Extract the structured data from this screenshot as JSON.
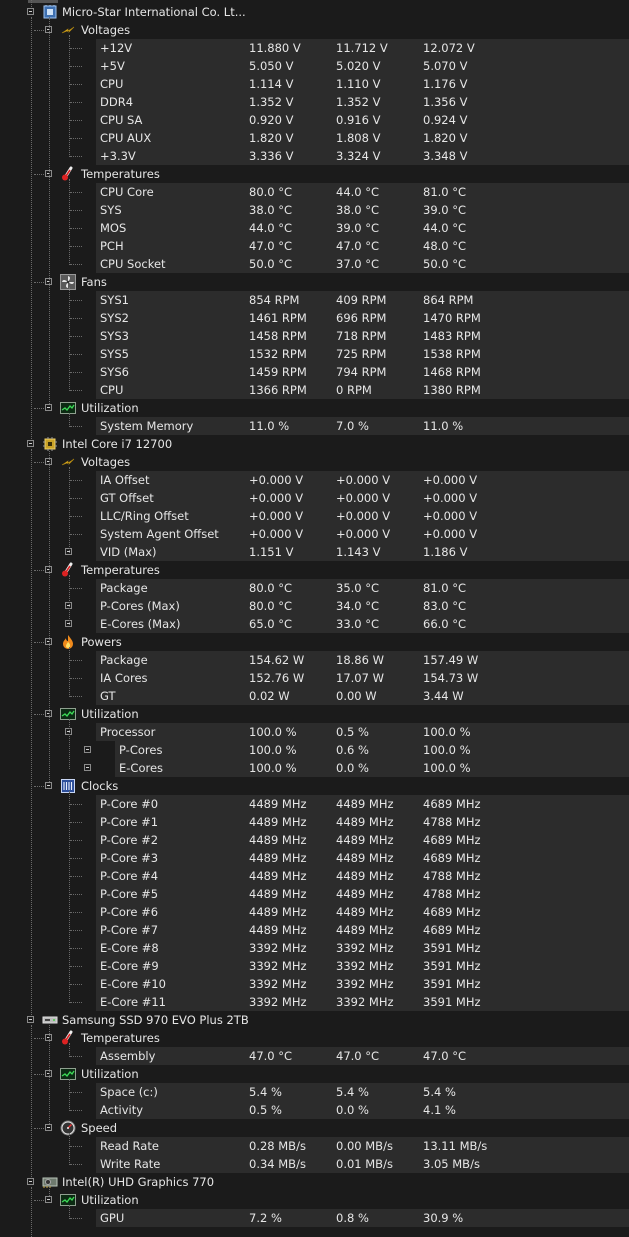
{
  "tree": [
    {
      "type": "device",
      "icon": "motherboard-icon",
      "label": "Micro-Star International Co. Lt..."
    },
    {
      "type": "group",
      "icon": "voltage-icon",
      "label": "Voltages"
    },
    {
      "type": "item",
      "label": "+12V",
      "values": [
        "11.880 V",
        "11.712 V",
        "12.072 V"
      ]
    },
    {
      "type": "item",
      "label": "+5V",
      "values": [
        "5.050 V",
        "5.020 V",
        "5.070 V"
      ]
    },
    {
      "type": "item",
      "label": "CPU",
      "values": [
        "1.114 V",
        "1.110 V",
        "1.176 V"
      ]
    },
    {
      "type": "item",
      "label": "DDR4",
      "values": [
        "1.352 V",
        "1.352 V",
        "1.356 V"
      ]
    },
    {
      "type": "item",
      "label": "CPU SA",
      "values": [
        "0.920 V",
        "0.916 V",
        "0.924 V"
      ]
    },
    {
      "type": "item",
      "label": "CPU AUX",
      "values": [
        "1.820 V",
        "1.808 V",
        "1.820 V"
      ]
    },
    {
      "type": "item",
      "label": "+3.3V",
      "values": [
        "3.336 V",
        "3.324 V",
        "3.348 V"
      ]
    },
    {
      "type": "group",
      "icon": "thermometer-icon",
      "label": "Temperatures"
    },
    {
      "type": "item",
      "label": "CPU Core",
      "values": [
        "80.0 °C",
        "44.0 °C",
        "81.0 °C"
      ]
    },
    {
      "type": "item",
      "label": "SYS",
      "values": [
        "38.0 °C",
        "38.0 °C",
        "39.0 °C"
      ]
    },
    {
      "type": "item",
      "label": "MOS",
      "values": [
        "44.0 °C",
        "39.0 °C",
        "44.0 °C"
      ]
    },
    {
      "type": "item",
      "label": "PCH",
      "values": [
        "47.0 °C",
        "47.0 °C",
        "48.0 °C"
      ]
    },
    {
      "type": "item",
      "label": "CPU Socket",
      "values": [
        "50.0 °C",
        "37.0 °C",
        "50.0 °C"
      ]
    },
    {
      "type": "group",
      "icon": "fan-icon",
      "label": "Fans"
    },
    {
      "type": "item",
      "label": "SYS1",
      "values": [
        "854 RPM",
        "409 RPM",
        "864 RPM"
      ]
    },
    {
      "type": "item",
      "label": "SYS2",
      "values": [
        "1461 RPM",
        "696 RPM",
        "1470 RPM"
      ]
    },
    {
      "type": "item",
      "label": "SYS3",
      "values": [
        "1458 RPM",
        "718 RPM",
        "1483 RPM"
      ]
    },
    {
      "type": "item",
      "label": "SYS5",
      "values": [
        "1532 RPM",
        "725 RPM",
        "1538 RPM"
      ]
    },
    {
      "type": "item",
      "label": "SYS6",
      "values": [
        "1459 RPM",
        "794 RPM",
        "1468 RPM"
      ]
    },
    {
      "type": "item",
      "label": "CPU",
      "values": [
        "1366 RPM",
        "0 RPM",
        "1380 RPM"
      ]
    },
    {
      "type": "group",
      "icon": "utilization-icon",
      "label": "Utilization"
    },
    {
      "type": "item",
      "label": "System Memory",
      "values": [
        "11.0 %",
        "7.0 %",
        "11.0 %"
      ]
    },
    {
      "type": "device",
      "icon": "cpu-chip-icon",
      "label": "Intel Core i7 12700"
    },
    {
      "type": "group",
      "icon": "voltage-icon",
      "label": "Voltages"
    },
    {
      "type": "item",
      "label": "IA Offset",
      "values": [
        "+0.000 V",
        "+0.000 V",
        "+0.000 V"
      ]
    },
    {
      "type": "item",
      "label": "GT Offset",
      "values": [
        "+0.000 V",
        "+0.000 V",
        "+0.000 V"
      ]
    },
    {
      "type": "item",
      "label": "LLC/Ring Offset",
      "values": [
        "+0.000 V",
        "+0.000 V",
        "+0.000 V"
      ]
    },
    {
      "type": "item",
      "label": "System Agent Offset",
      "values": [
        "+0.000 V",
        "+0.000 V",
        "+0.000 V"
      ]
    },
    {
      "type": "item",
      "label": "VID (Max)",
      "expander": true,
      "values": [
        "1.151 V",
        "1.143 V",
        "1.186 V"
      ]
    },
    {
      "type": "group",
      "icon": "thermometer-icon",
      "label": "Temperatures"
    },
    {
      "type": "item",
      "label": "Package",
      "values": [
        "80.0 °C",
        "35.0 °C",
        "81.0 °C"
      ]
    },
    {
      "type": "item",
      "label": "P-Cores (Max)",
      "expander": true,
      "values": [
        "80.0 °C",
        "34.0 °C",
        "83.0 °C"
      ]
    },
    {
      "type": "item",
      "label": "E-Cores (Max)",
      "expander": true,
      "values": [
        "65.0 °C",
        "33.0 °C",
        "66.0 °C"
      ]
    },
    {
      "type": "group",
      "icon": "power-flame-icon",
      "label": "Powers"
    },
    {
      "type": "item",
      "label": "Package",
      "values": [
        "154.62 W",
        "18.86 W",
        "157.49 W"
      ]
    },
    {
      "type": "item",
      "label": "IA Cores",
      "values": [
        "152.76 W",
        "17.07 W",
        "154.73 W"
      ]
    },
    {
      "type": "item",
      "label": "GT",
      "values": [
        "0.02 W",
        "0.00 W",
        "3.44 W"
      ]
    },
    {
      "type": "group",
      "icon": "utilization-icon",
      "label": "Utilization"
    },
    {
      "type": "item",
      "label": "Processor",
      "expander": true,
      "values": [
        "100.0 %",
        "0.5 %",
        "100.0 %"
      ]
    },
    {
      "type": "subitem",
      "label": "P-Cores",
      "values": [
        "100.0 %",
        "0.6 %",
        "100.0 %"
      ]
    },
    {
      "type": "subitem",
      "label": "E-Cores",
      "values": [
        "100.0 %",
        "0.0 %",
        "100.0 %"
      ]
    },
    {
      "type": "group",
      "icon": "clock-icon",
      "label": "Clocks"
    },
    {
      "type": "item",
      "label": "P-Core #0",
      "values": [
        "4489 MHz",
        "4489 MHz",
        "4689 MHz"
      ]
    },
    {
      "type": "item",
      "label": "P-Core #1",
      "values": [
        "4489 MHz",
        "4489 MHz",
        "4788 MHz"
      ]
    },
    {
      "type": "item",
      "label": "P-Core #2",
      "values": [
        "4489 MHz",
        "4489 MHz",
        "4689 MHz"
      ]
    },
    {
      "type": "item",
      "label": "P-Core #3",
      "values": [
        "4489 MHz",
        "4489 MHz",
        "4689 MHz"
      ]
    },
    {
      "type": "item",
      "label": "P-Core #4",
      "values": [
        "4489 MHz",
        "4489 MHz",
        "4788 MHz"
      ]
    },
    {
      "type": "item",
      "label": "P-Core #5",
      "values": [
        "4489 MHz",
        "4489 MHz",
        "4788 MHz"
      ]
    },
    {
      "type": "item",
      "label": "P-Core #6",
      "values": [
        "4489 MHz",
        "4489 MHz",
        "4689 MHz"
      ]
    },
    {
      "type": "item",
      "label": "P-Core #7",
      "values": [
        "4489 MHz",
        "4489 MHz",
        "4689 MHz"
      ]
    },
    {
      "type": "item",
      "label": "E-Core #8",
      "values": [
        "3392 MHz",
        "3392 MHz",
        "3591 MHz"
      ]
    },
    {
      "type": "item",
      "label": "E-Core #9",
      "values": [
        "3392 MHz",
        "3392 MHz",
        "3591 MHz"
      ]
    },
    {
      "type": "item",
      "label": "E-Core #10",
      "values": [
        "3392 MHz",
        "3392 MHz",
        "3591 MHz"
      ]
    },
    {
      "type": "item",
      "label": "E-Core #11",
      "values": [
        "3392 MHz",
        "3392 MHz",
        "3591 MHz"
      ]
    },
    {
      "type": "device",
      "icon": "ssd-drive-icon",
      "label": "Samsung SSD 970 EVO Plus 2TB"
    },
    {
      "type": "group",
      "icon": "thermometer-icon",
      "label": "Temperatures"
    },
    {
      "type": "item",
      "label": "Assembly",
      "values": [
        "47.0 °C",
        "47.0 °C",
        "47.0 °C"
      ]
    },
    {
      "type": "group",
      "icon": "utilization-icon",
      "label": "Utilization"
    },
    {
      "type": "item",
      "label": "Space (c:)",
      "values": [
        "5.4 %",
        "5.4 %",
        "5.4 %"
      ]
    },
    {
      "type": "item",
      "label": "Activity",
      "values": [
        "0.5 %",
        "0.0 %",
        "4.1 %"
      ]
    },
    {
      "type": "group",
      "icon": "speedometer-icon",
      "label": "Speed"
    },
    {
      "type": "item",
      "label": "Read Rate",
      "values": [
        "0.28 MB/s",
        "0.00 MB/s",
        "13.11 MB/s"
      ]
    },
    {
      "type": "item",
      "label": "Write Rate",
      "values": [
        "0.34 MB/s",
        "0.01 MB/s",
        "3.05 MB/s"
      ]
    },
    {
      "type": "device",
      "icon": "gpu-card-icon",
      "label": "Intel(R) UHD Graphics 770"
    },
    {
      "type": "group",
      "icon": "utilization-icon",
      "label": "Utilization"
    },
    {
      "type": "item",
      "label": "GPU",
      "values": [
        "7.2 %",
        "0.8 %",
        "30.9 %"
      ]
    }
  ],
  "colors": {
    "background": "#1b1b1b",
    "stripe": "#2c2c2c",
    "text": "#e6e6e6",
    "treeline": "#6a6a6a"
  }
}
